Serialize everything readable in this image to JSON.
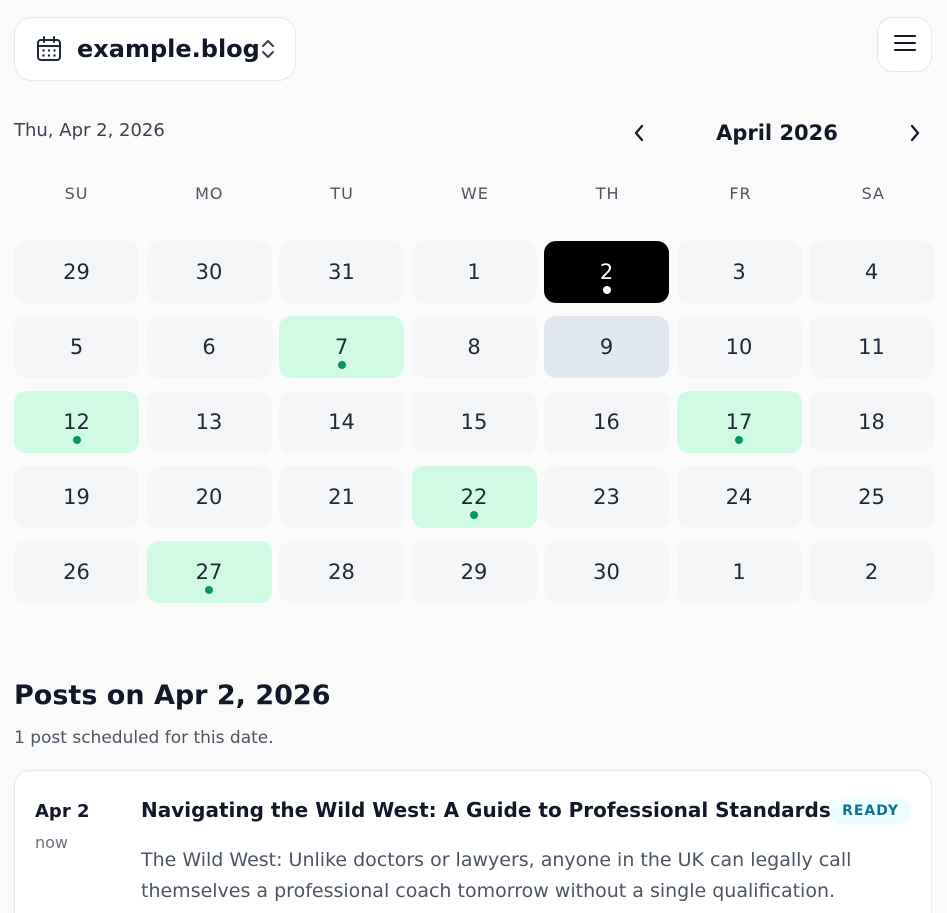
{
  "header": {
    "site_name": "example.blog",
    "calendar_icon": "calendar-icon",
    "switch_icon": "chevron-up-down-icon",
    "menu_icon": "hamburger-menu-icon"
  },
  "calendar": {
    "selected_date_label": "Thu, Apr 2, 2026",
    "month_label": "April 2026",
    "prev_icon": "chevron-left-icon",
    "next_icon": "chevron-right-icon",
    "weekdays": [
      "SU",
      "MO",
      "TU",
      "WE",
      "TH",
      "FR",
      "SA"
    ],
    "days": [
      {
        "label": "29",
        "state": "default",
        "dot": false
      },
      {
        "label": "30",
        "state": "default",
        "dot": false
      },
      {
        "label": "31",
        "state": "default",
        "dot": false
      },
      {
        "label": "1",
        "state": "default",
        "dot": false
      },
      {
        "label": "2",
        "state": "selected",
        "dot": true
      },
      {
        "label": "3",
        "state": "default",
        "dot": false
      },
      {
        "label": "4",
        "state": "default",
        "dot": false
      },
      {
        "label": "5",
        "state": "default",
        "dot": false
      },
      {
        "label": "6",
        "state": "default",
        "dot": false
      },
      {
        "label": "7",
        "state": "has-post",
        "dot": true
      },
      {
        "label": "8",
        "state": "default",
        "dot": false
      },
      {
        "label": "9",
        "state": "today",
        "dot": false
      },
      {
        "label": "10",
        "state": "default",
        "dot": false
      },
      {
        "label": "11",
        "state": "default",
        "dot": false
      },
      {
        "label": "12",
        "state": "has-post",
        "dot": true
      },
      {
        "label": "13",
        "state": "default",
        "dot": false
      },
      {
        "label": "14",
        "state": "default",
        "dot": false
      },
      {
        "label": "15",
        "state": "default",
        "dot": false
      },
      {
        "label": "16",
        "state": "default",
        "dot": false
      },
      {
        "label": "17",
        "state": "has-post",
        "dot": true
      },
      {
        "label": "18",
        "state": "default",
        "dot": false
      },
      {
        "label": "19",
        "state": "default",
        "dot": false
      },
      {
        "label": "20",
        "state": "default",
        "dot": false
      },
      {
        "label": "21",
        "state": "default",
        "dot": false
      },
      {
        "label": "22",
        "state": "has-post",
        "dot": true
      },
      {
        "label": "23",
        "state": "default",
        "dot": false
      },
      {
        "label": "24",
        "state": "default",
        "dot": false
      },
      {
        "label": "25",
        "state": "default",
        "dot": false
      },
      {
        "label": "26",
        "state": "default",
        "dot": false
      },
      {
        "label": "27",
        "state": "has-post",
        "dot": true
      },
      {
        "label": "28",
        "state": "default",
        "dot": false
      },
      {
        "label": "29",
        "state": "default",
        "dot": false
      },
      {
        "label": "30",
        "state": "default",
        "dot": false
      },
      {
        "label": "1",
        "state": "default",
        "dot": false
      },
      {
        "label": "2",
        "state": "default",
        "dot": false
      }
    ]
  },
  "posts": {
    "title": "Posts on Apr 2, 2026",
    "count_label": "1 post scheduled for this date.",
    "items": [
      {
        "date": "Apr 2",
        "time": "now",
        "title": "Navigating the Wild West: A Guide to Professional Standards",
        "status": "READY",
        "excerpt": "The Wild West: Unlike doctors or lawyers, anyone in the UK can legally call themselves a professional coach tomorrow without a single qualification."
      }
    ]
  },
  "colors": {
    "selected_bg": "#000000",
    "has_post_bg": "#d1fae5",
    "today_bg": "#e2e8f0",
    "dot": "#059669",
    "badge_bg": "#ecfeff",
    "badge_text": "#0e7490"
  }
}
